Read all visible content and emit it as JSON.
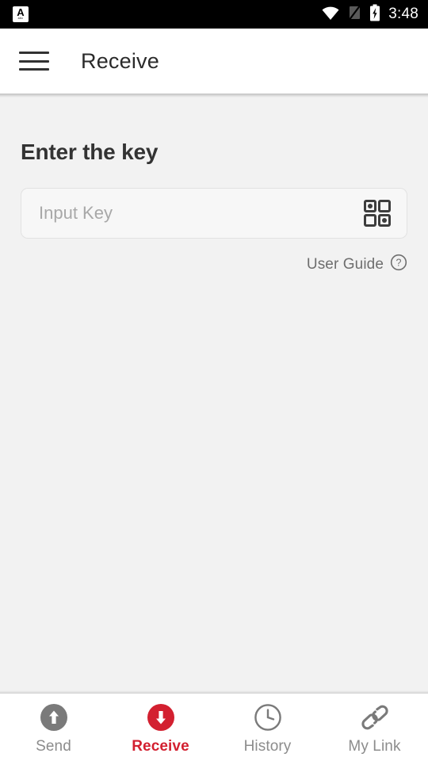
{
  "status_bar": {
    "app_badge_glyph": "A",
    "app_badge_sub": "abc",
    "icons": [
      "wifi-icon",
      "cellular-off-icon",
      "battery-charging-icon"
    ],
    "time": "3:48",
    "background_color": "#000000"
  },
  "app_bar": {
    "menu_icon": "hamburger-menu-icon",
    "title": "Receive",
    "background_color": "#ffffff",
    "title_color": "#2b2b2b"
  },
  "main": {
    "section_title": "Enter the key",
    "key_input": {
      "value": "",
      "placeholder": "Input Key",
      "scan_icon": "qr-code-icon"
    },
    "user_guide": {
      "label": "User Guide",
      "icon": "help-circle-icon"
    },
    "background_color": "#f2f2f2"
  },
  "bottom_nav": {
    "active_color": "#d32030",
    "inactive_color": "#8c8c8c",
    "items": [
      {
        "label": "Send",
        "icon": "arrow-up-circle-icon",
        "active": false
      },
      {
        "label": "Receive",
        "icon": "arrow-down-circle-icon",
        "active": true
      },
      {
        "label": "History",
        "icon": "clock-icon",
        "active": false
      },
      {
        "label": "My Link",
        "icon": "link-icon",
        "active": false
      }
    ]
  }
}
